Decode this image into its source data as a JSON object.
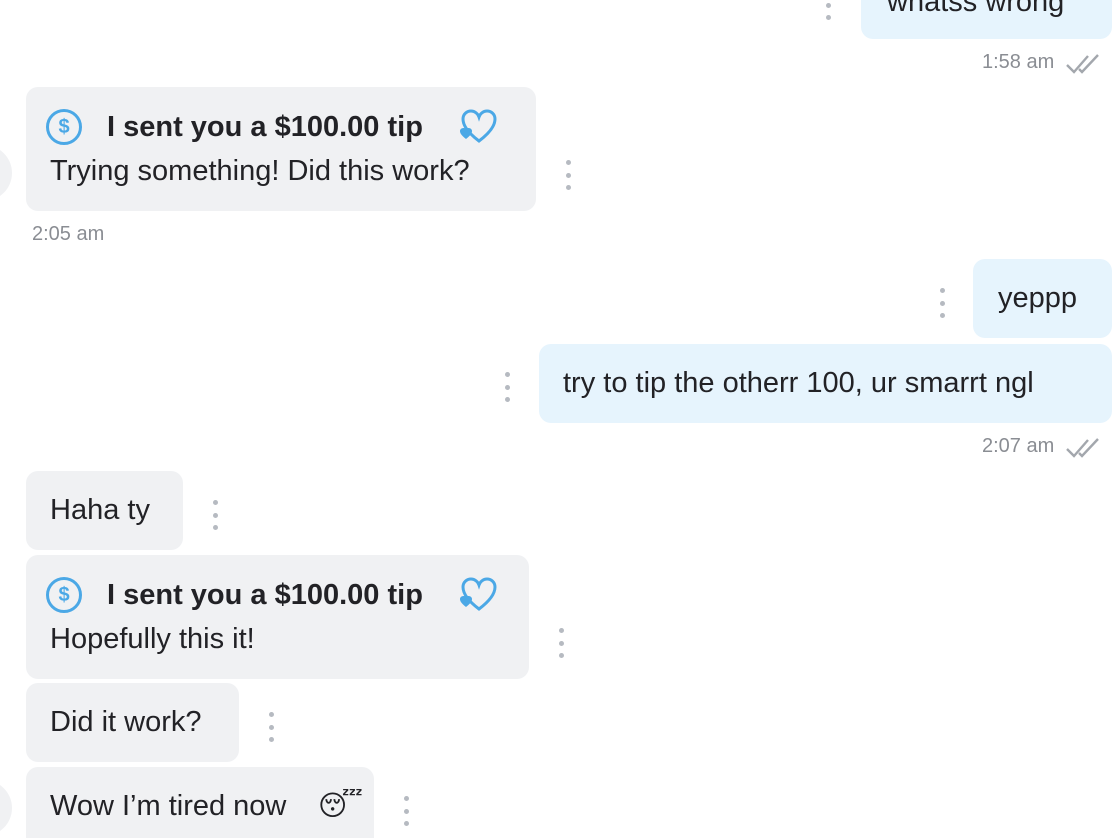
{
  "messages": {
    "m0": {
      "text": "whatss wrong",
      "time": "1:58 am"
    },
    "m1": {
      "tip_title": "I sent you a $100.00 tip",
      "text": "Trying something! Did this work?",
      "time": "2:05 am"
    },
    "m2": {
      "text": "yeppp"
    },
    "m3": {
      "text": "try to tip the otherr 100, ur smarrt ngl",
      "time": "2:07 am"
    },
    "m4": {
      "text": "Haha ty"
    },
    "m5": {
      "tip_title": "I sent you a $100.00 tip",
      "text": "Hopefully this it!"
    },
    "m6": {
      "text": "Did it work?"
    },
    "m7": {
      "text": "Wow I’m tired now",
      "emoji": "😴"
    }
  },
  "icons": {
    "dollar": "$",
    "read_receipt": "double-check-icon",
    "tip_heart": "heart-icon"
  },
  "colors": {
    "incoming_bubble": "#f0f1f3",
    "outgoing_bubble": "#e6f4fd",
    "accent": "#4ba8e6",
    "timestamp": "#8a8d93"
  }
}
